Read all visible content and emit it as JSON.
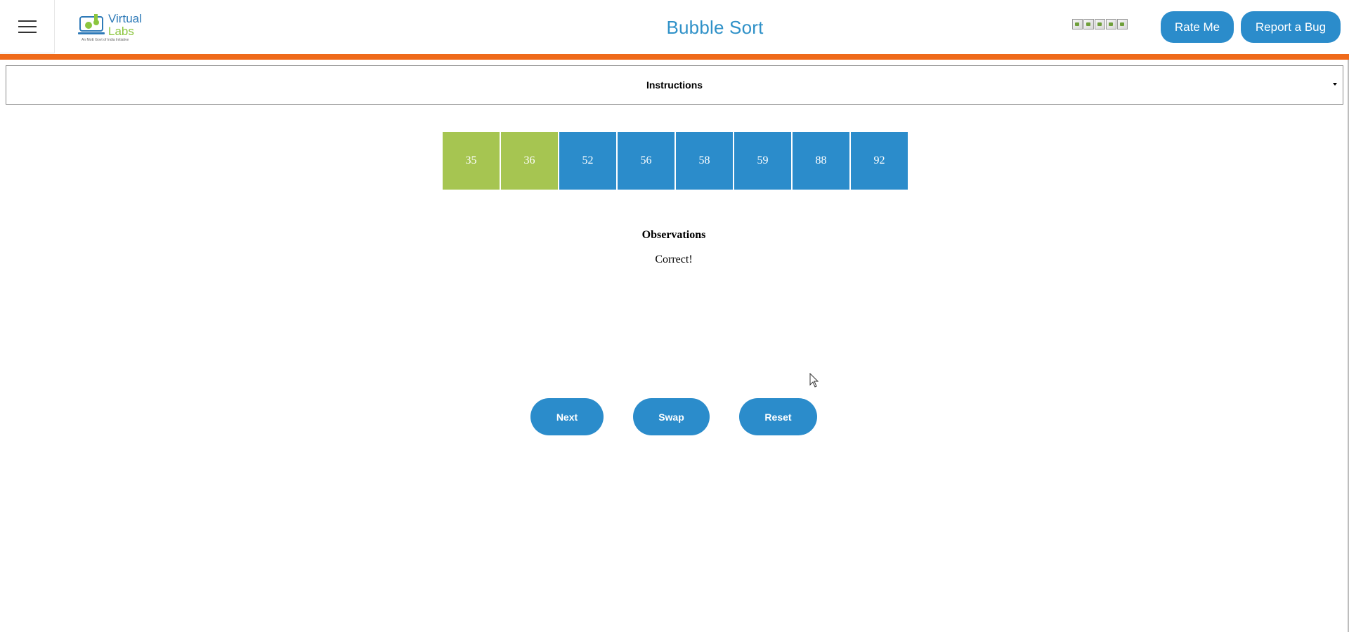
{
  "header": {
    "title": "Bubble Sort",
    "logo": {
      "line1": "Virtual",
      "line2": "Labs",
      "tagline": "An MoE Govt of India Initiative"
    },
    "rate_label": "Rate Me",
    "bug_label": "Report a Bug",
    "rating_images_count": 5
  },
  "instructions": {
    "label": "Instructions"
  },
  "array": {
    "cells": [
      {
        "value": "35",
        "state": "sorted"
      },
      {
        "value": "36",
        "state": "sorted"
      },
      {
        "value": "52",
        "state": "unsorted"
      },
      {
        "value": "56",
        "state": "unsorted"
      },
      {
        "value": "58",
        "state": "unsorted"
      },
      {
        "value": "59",
        "state": "unsorted"
      },
      {
        "value": "88",
        "state": "unsorted"
      },
      {
        "value": "92",
        "state": "unsorted"
      }
    ]
  },
  "observations": {
    "title": "Observations",
    "text": "Correct!"
  },
  "controls": {
    "next_label": "Next",
    "swap_label": "Swap",
    "reset_label": "Reset"
  },
  "colors": {
    "accent_blue": "#2b8ccb",
    "title_blue": "#2f91c8",
    "orange": "#ef6a1a",
    "sorted_green": "#a6c551",
    "unsorted_blue": "#2b8ccb"
  }
}
